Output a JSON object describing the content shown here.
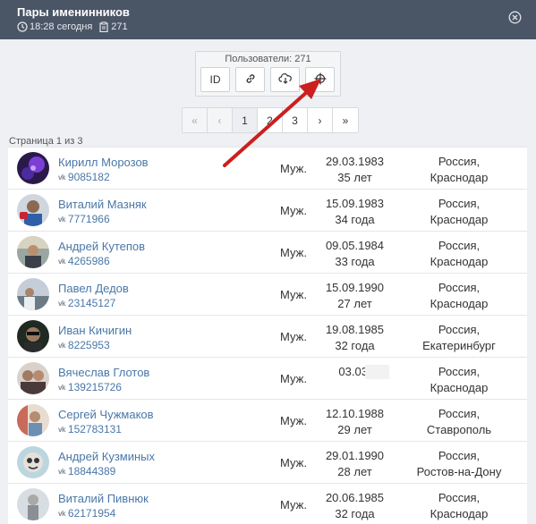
{
  "header": {
    "title": "Пары именинников",
    "time": "18:28 сегодня",
    "count": "271"
  },
  "toolbar": {
    "label": "Пользователи: 271",
    "id_button": "ID"
  },
  "pagination": {
    "first": "«",
    "prev": "‹",
    "pages": [
      "1",
      "2",
      "3"
    ],
    "next": "›",
    "last": "»",
    "info": "Страница 1 из 3"
  },
  "users": [
    {
      "name": "Кирилл Морозов",
      "vk": "9085182",
      "sex": "Муж.",
      "bdate": "29.03.1983",
      "age": "35 лет",
      "country": "Россия,",
      "city": "Краснодар"
    },
    {
      "name": "Виталий Мазняк",
      "vk": "7771966",
      "sex": "Муж.",
      "bdate": "15.09.1983",
      "age": "34 года",
      "country": "Россия,",
      "city": "Краснодар"
    },
    {
      "name": "Андрей Кутепов",
      "vk": "4265986",
      "sex": "Муж.",
      "bdate": "09.05.1984",
      "age": "33 года",
      "country": "Россия,",
      "city": "Краснодар"
    },
    {
      "name": "Павел Дедов",
      "vk": "23145127",
      "sex": "Муж.",
      "bdate": "15.09.1990",
      "age": "27 лет",
      "country": "Россия,",
      "city": "Краснодар"
    },
    {
      "name": "Иван Кичигин",
      "vk": "8225953",
      "sex": "Муж.",
      "bdate": "19.08.1985",
      "age": "32 года",
      "country": "Россия,",
      "city": "Екатеринбург"
    },
    {
      "name": "Вячеслав Глотов",
      "vk": "139215726",
      "sex": "Муж.",
      "bdate": "03.03.",
      "age": "",
      "country": "Россия,",
      "city": "Краснодар"
    },
    {
      "name": "Сергей Чужмаков",
      "vk": "152783131",
      "sex": "Муж.",
      "bdate": "12.10.1988",
      "age": "29 лет",
      "country": "Россия,",
      "city": "Ставрополь"
    },
    {
      "name": "Андрей Кузминых",
      "vk": "18844389",
      "sex": "Муж.",
      "bdate": "29.01.1990",
      "age": "28 лет",
      "country": "Россия,",
      "city": "Ростов-на-Дону"
    },
    {
      "name": "Виталий Пивнюк",
      "vk": "62171954",
      "sex": "Муж.",
      "bdate": "20.06.1985",
      "age": "32 года",
      "country": "Россия,",
      "city": "Краснодар"
    }
  ],
  "colors": {
    "header_bg": "#4a5566",
    "link": "#4a77a8",
    "arrow": "#cc1f1f"
  }
}
